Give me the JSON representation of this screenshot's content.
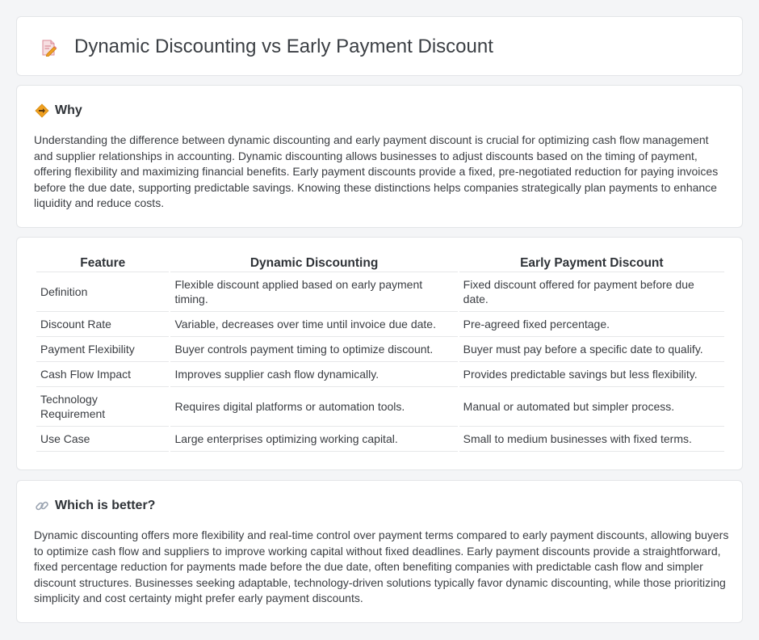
{
  "header": {
    "title": "Dynamic Discounting vs Early Payment Discount",
    "icon": "document-pencil-icon"
  },
  "why": {
    "title": "Why",
    "icon": "diamond-signpost-icon",
    "body": "Understanding the difference between dynamic discounting and early payment discount is crucial for optimizing cash flow management and supplier relationships in accounting. Dynamic discounting allows businesses to adjust discounts based on the timing of payment, offering flexibility and maximizing financial benefits. Early payment discounts provide a fixed, pre-negotiated reduction for paying invoices before the due date, supporting predictable savings. Knowing these distinctions helps companies strategically plan payments to enhance liquidity and reduce costs."
  },
  "table": {
    "headers": [
      "Feature",
      "Dynamic Discounting",
      "Early Payment Discount"
    ],
    "rows": [
      [
        "Definition",
        "Flexible discount applied based on early payment timing.",
        "Fixed discount offered for payment before due date."
      ],
      [
        "Discount Rate",
        "Variable, decreases over time until invoice due date.",
        "Pre-agreed fixed percentage."
      ],
      [
        "Payment Flexibility",
        "Buyer controls payment timing to optimize discount.",
        "Buyer must pay before a specific date to qualify."
      ],
      [
        "Cash Flow Impact",
        "Improves supplier cash flow dynamically.",
        "Provides predictable savings but less flexibility."
      ],
      [
        "Technology Requirement",
        "Requires digital platforms or automation tools.",
        "Manual or automated but simpler process."
      ],
      [
        "Use Case",
        "Large enterprises optimizing working capital.",
        "Small to medium businesses with fixed terms."
      ]
    ]
  },
  "better": {
    "title": "Which is better?",
    "icon": "link-icon",
    "body": "Dynamic discounting offers more flexibility and real-time control over payment terms compared to early payment discounts, allowing buyers to optimize cash flow and suppliers to improve working capital without fixed deadlines. Early payment discounts provide a straightforward, fixed percentage reduction for payments made before the due date, often benefiting companies with predictable cash flow and simpler discount structures. Businesses seeking adaptable, technology-driven solutions typically favor dynamic discounting, while those prioritizing simplicity and cost certainty might prefer early payment discounts."
  },
  "colors": {
    "background": "#f4f5f7",
    "card": "#ffffff",
    "border": "#e3e5e8",
    "icon_orange": "#f0a020",
    "icon_pink": "#e57b8a"
  }
}
